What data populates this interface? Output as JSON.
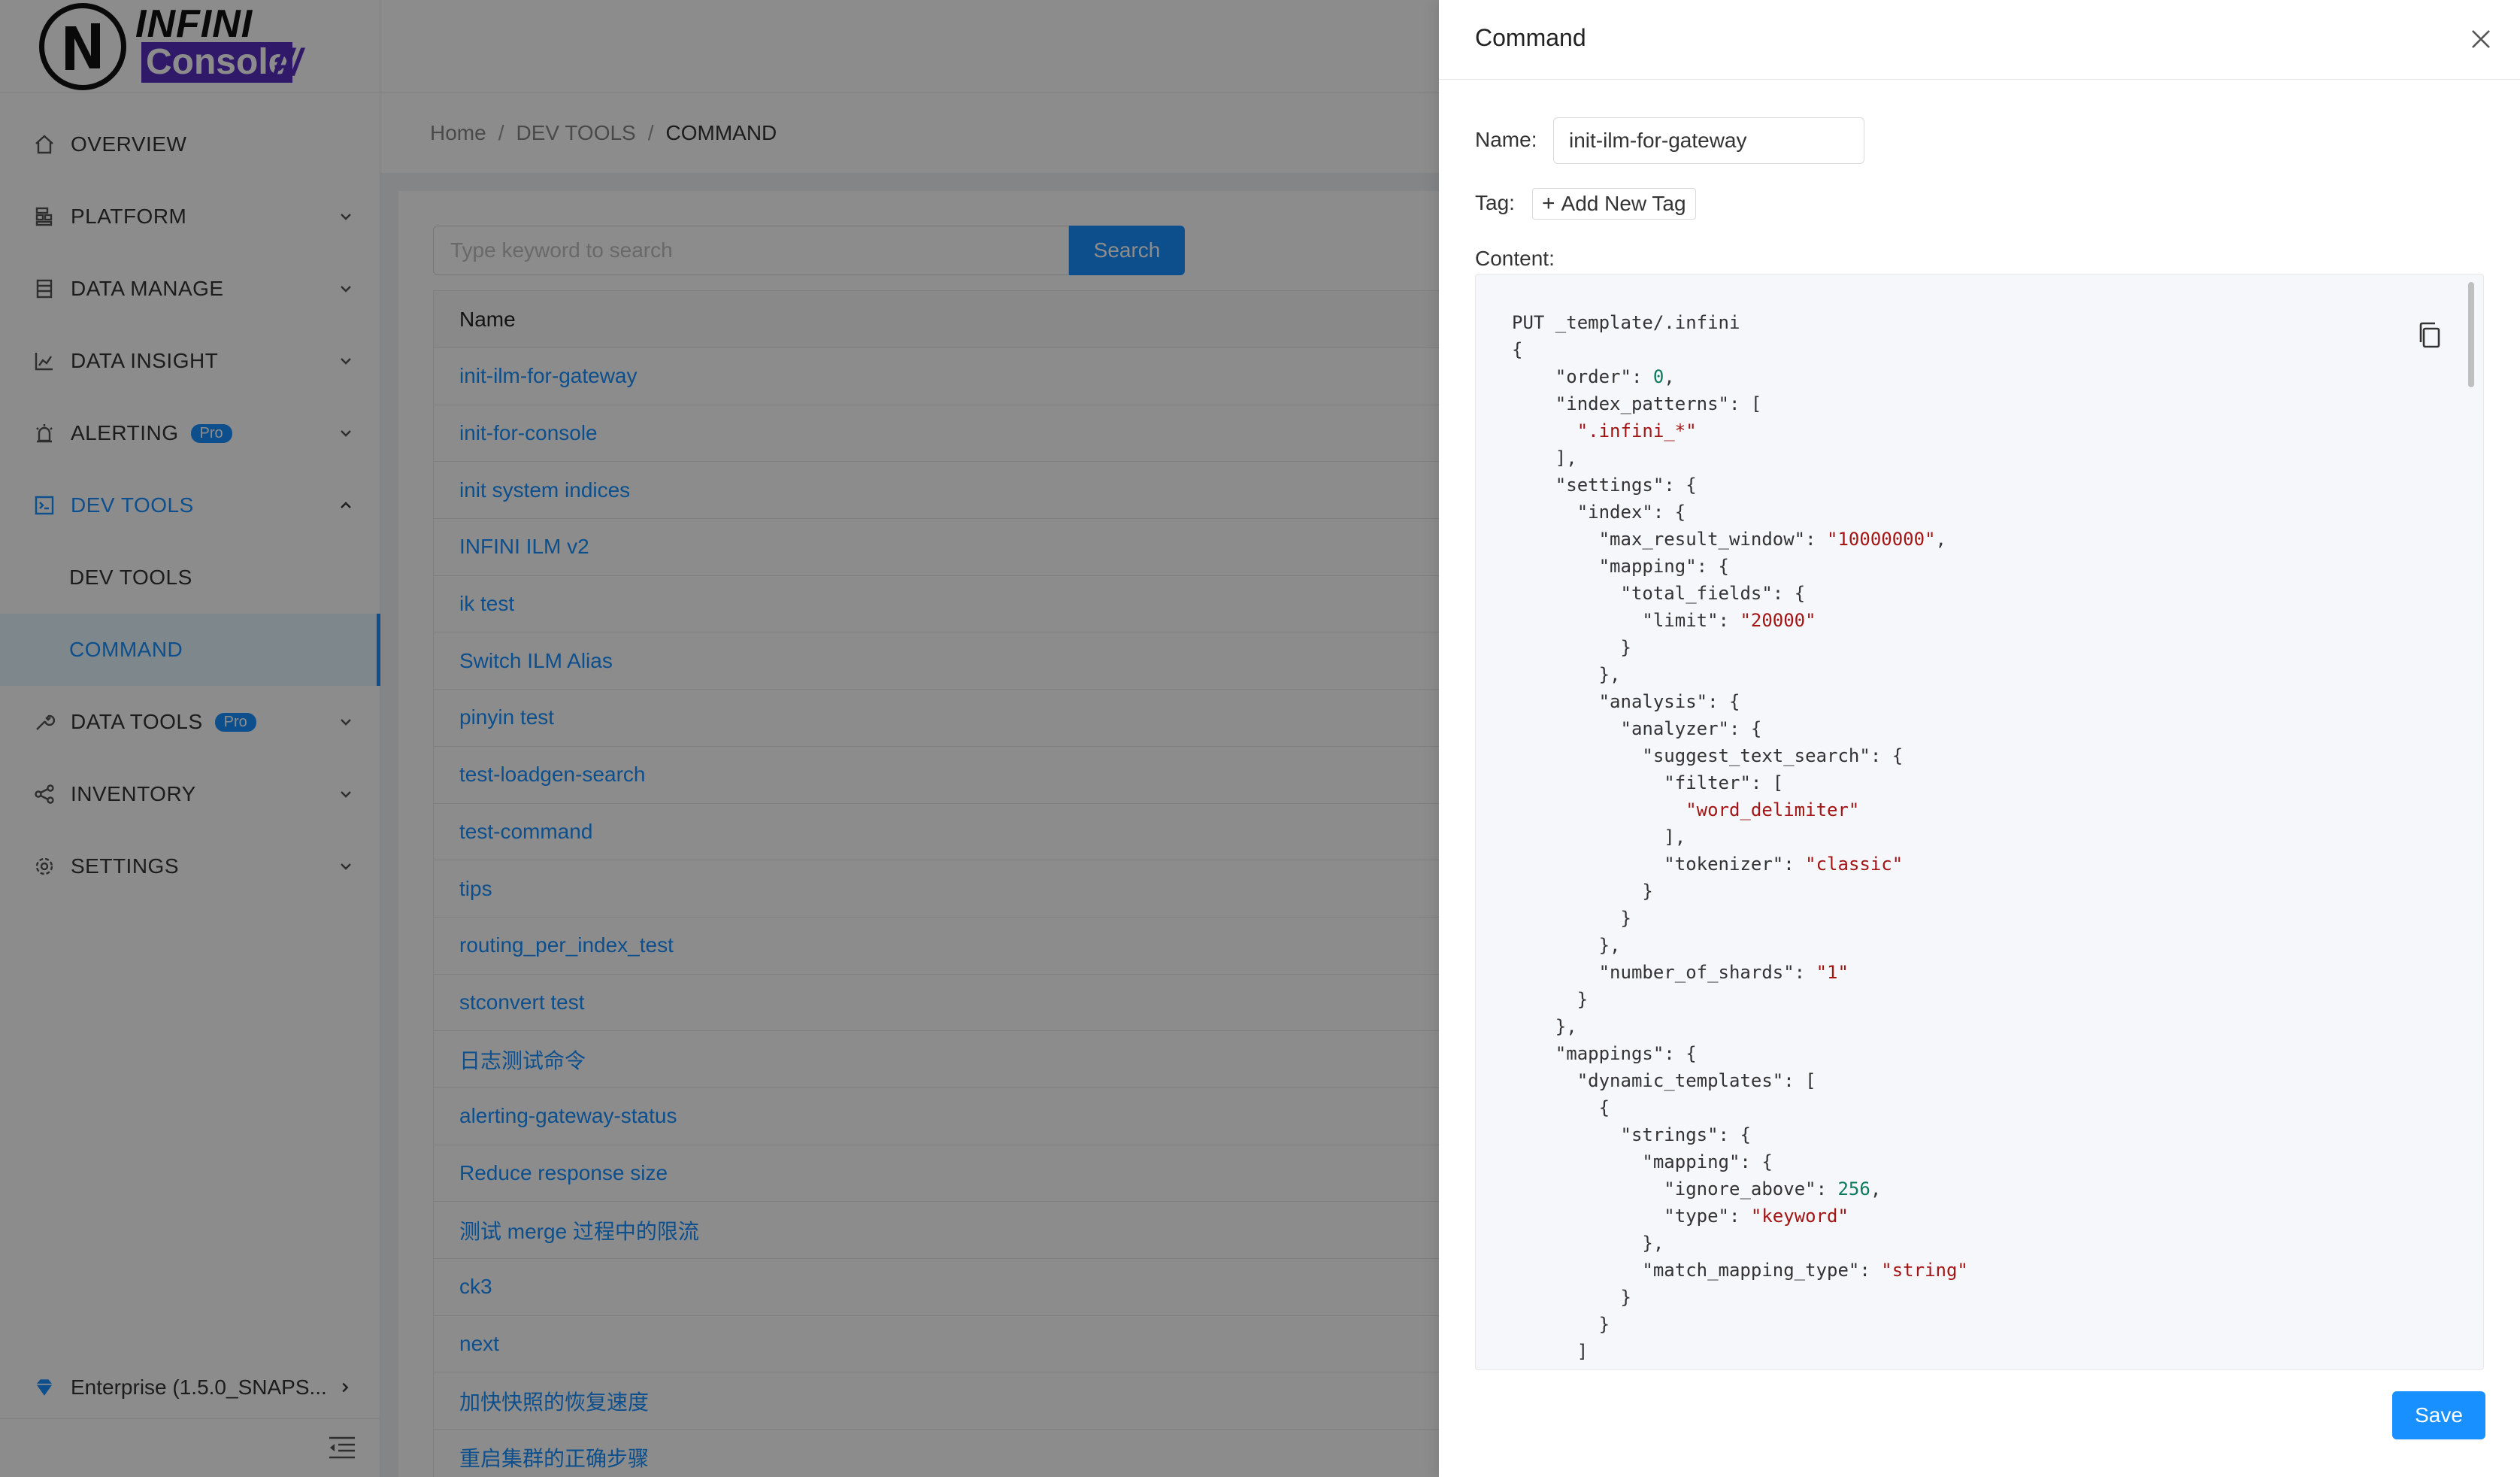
{
  "brand": {
    "name_top": "INFINI",
    "name_bottom": "Console",
    "slashes": "///"
  },
  "sidebar": {
    "items": [
      {
        "label": "OVERVIEW"
      },
      {
        "label": "PLATFORM"
      },
      {
        "label": "DATA MANAGE"
      },
      {
        "label": "DATA INSIGHT"
      },
      {
        "label": "ALERTING",
        "badge": "Pro"
      },
      {
        "label": "DEV TOOLS"
      },
      {
        "label": "DEV TOOLS"
      },
      {
        "label": "COMMAND"
      },
      {
        "label": "DATA TOOLS",
        "badge": "Pro"
      },
      {
        "label": "INVENTORY"
      },
      {
        "label": "SETTINGS"
      }
    ],
    "enterprise": "Enterprise (1.5.0_SNAPS..."
  },
  "breadcrumb": {
    "home": "Home",
    "section": "DEV TOOLS",
    "current": "COMMAND",
    "sep": "/"
  },
  "search": {
    "placeholder": "Type keyword to search",
    "button": "Search"
  },
  "table": {
    "header": "Name",
    "rows": [
      "init-ilm-for-gateway",
      "init-for-console",
      "init system indices",
      "INFINI ILM v2",
      "ik test",
      "Switch ILM Alias",
      "pinyin test",
      "test-loadgen-search",
      "test-command",
      "tips",
      "routing_per_index_test",
      "stconvert test",
      "日志测试命令",
      "alerting-gateway-status",
      "Reduce response size",
      "测试 merge 过程中的限流",
      "ck3",
      "next",
      "加快快照的恢复速度",
      "重启集群的正确步骤"
    ]
  },
  "drawer": {
    "title": "Command",
    "name_label": "Name:",
    "name_value": "init-ilm-for-gateway",
    "tag_label": "Tag:",
    "add_tag": "Add New Tag",
    "content_label": "Content:",
    "save": "Save",
    "code_lines": [
      "PUT _template/.infini",
      "{",
      "    \"order\": 0,",
      "    \"index_patterns\": [",
      "      \".infini_*\"",
      "    ],",
      "    \"settings\": {",
      "      \"index\": {",
      "        \"max_result_window\": \"10000000\",",
      "        \"mapping\": {",
      "          \"total_fields\": {",
      "            \"limit\": \"20000\"",
      "          }",
      "        },",
      "        \"analysis\": {",
      "          \"analyzer\": {",
      "            \"suggest_text_search\": {",
      "              \"filter\": [",
      "                \"word_delimiter\"",
      "              ],",
      "              \"tokenizer\": \"classic\"",
      "            }",
      "          }",
      "        },",
      "        \"number_of_shards\": \"1\"",
      "      }",
      "    },",
      "    \"mappings\": {",
      "      \"dynamic_templates\": [",
      "        {",
      "          \"strings\": {",
      "            \"mapping\": {",
      "              \"ignore_above\": 256,",
      "              \"type\": \"keyword\"",
      "            },",
      "            \"match_mapping_type\": \"string\"",
      "          }",
      "        }",
      "      ]"
    ]
  },
  "colors": {
    "primary": "#1890ff",
    "brand": "#5a2fbf",
    "string": "#a31515",
    "number": "#0b7a5e"
  }
}
